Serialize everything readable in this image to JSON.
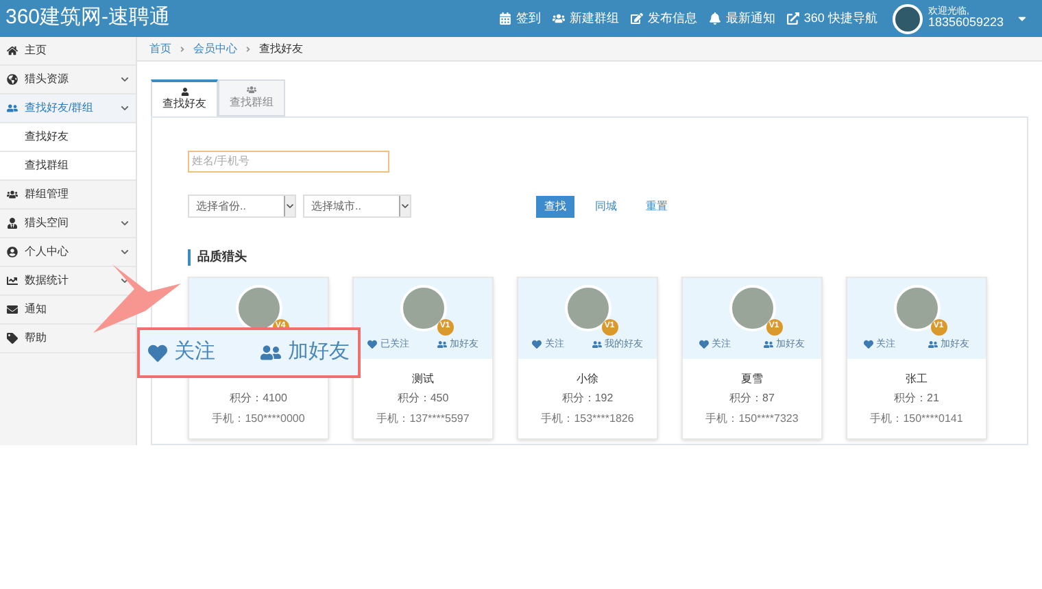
{
  "header": {
    "logo": "360建筑网-速聘通",
    "nav": [
      "签到",
      "新建群组",
      "发布信息",
      "最新通知",
      "360 快捷导航"
    ],
    "user": {
      "greeting": "欢迎光临,",
      "phone": "18356059223"
    }
  },
  "sidebar": {
    "items": [
      {
        "label": "主页",
        "selected": false,
        "collapsible": false
      },
      {
        "label": "猎头资源",
        "selected": false,
        "collapsible": true
      },
      {
        "label": "查找好友/群组",
        "selected": true,
        "collapsible": true,
        "children": [
          {
            "label": "查找好友"
          },
          {
            "label": "查找群组"
          }
        ]
      },
      {
        "label": "群组管理",
        "selected": false,
        "collapsible": false
      },
      {
        "label": "猎头空间",
        "selected": false,
        "collapsible": true
      },
      {
        "label": "个人中心",
        "selected": false,
        "collapsible": true
      },
      {
        "label": "数据统计",
        "selected": false,
        "collapsible": true
      },
      {
        "label": "通知",
        "selected": false,
        "collapsible": false
      },
      {
        "label": "帮助",
        "selected": false,
        "collapsible": false
      }
    ]
  },
  "breadcrumb": [
    "首页",
    "会员中心",
    "查找好友"
  ],
  "tabs": [
    {
      "label": "查找好友",
      "selected": true
    },
    {
      "label": "查找群组",
      "selected": false
    }
  ],
  "search": {
    "placeholder": "姓名/手机号",
    "province": "选择省份..",
    "city": "选择城市..",
    "buttons": [
      "查找",
      "同城",
      "重置"
    ]
  },
  "section_title": "品质猎头",
  "cards": [
    {
      "badge": "V4",
      "score": "积分：4100",
      "phone": "手机：150****0000"
    },
    {
      "badge": "V1",
      "follow": "已关注",
      "friend": "加好友",
      "name": "测试",
      "score": "积分：450",
      "phone": "手机：137****5597"
    },
    {
      "badge": "V1",
      "follow": "关注",
      "friend": "我的好友",
      "name": "小徐",
      "score": "积分：192",
      "phone": "手机：153****1826"
    },
    {
      "badge": "V1",
      "follow": "关注",
      "friend": "加好友",
      "name": "夏雪",
      "score": "积分：87",
      "phone": "手机：150****7323"
    },
    {
      "badge": "V1",
      "follow": "关注",
      "friend": "加好友",
      "name": "张工",
      "score": "积分：21",
      "phone": "手机：150****0141"
    }
  ],
  "callout": {
    "follow": "关注",
    "friend": "加好友"
  }
}
